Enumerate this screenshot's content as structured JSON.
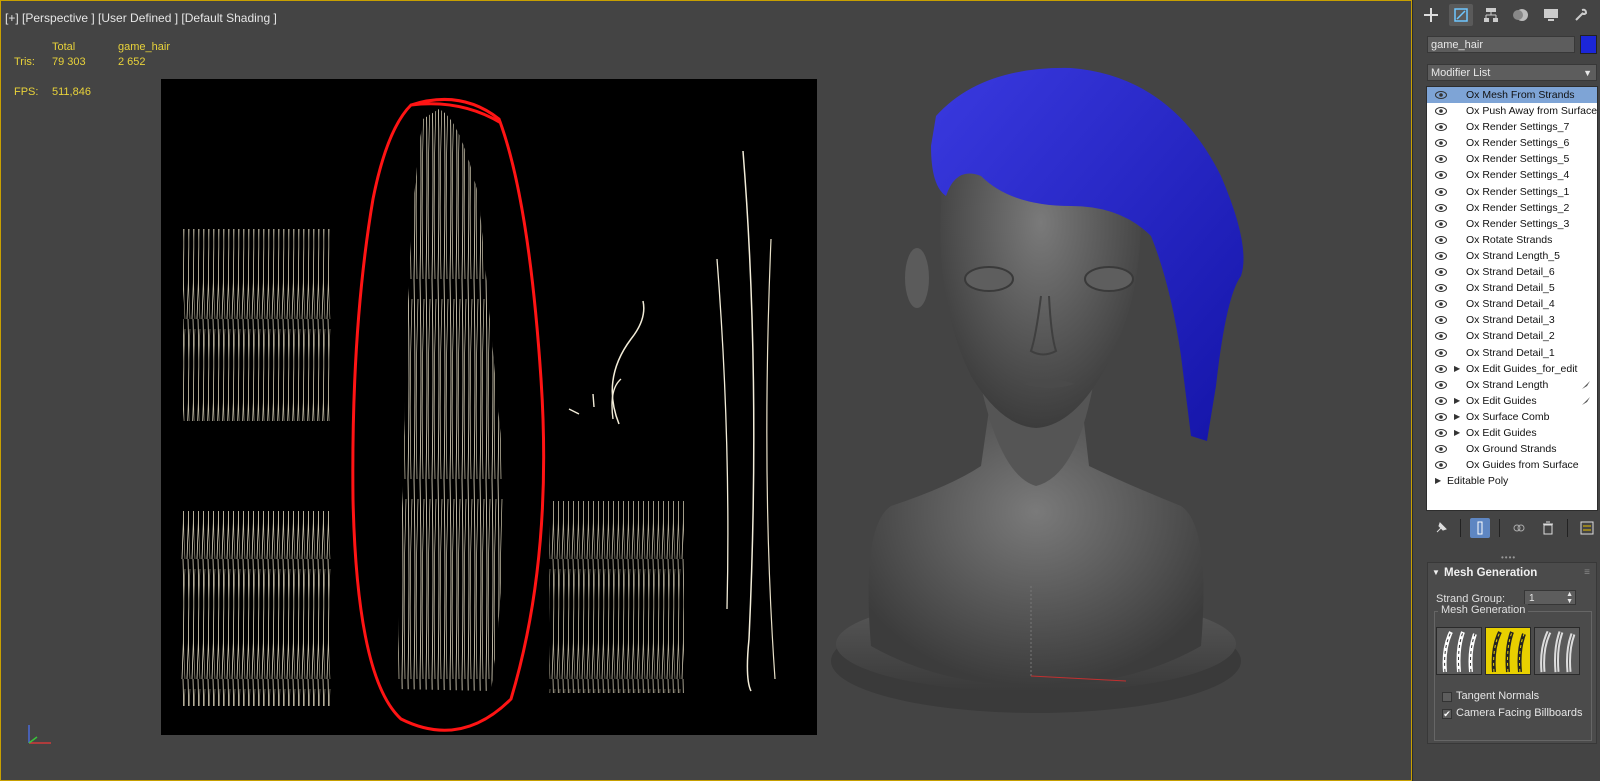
{
  "viewport": {
    "label": "[+] [Perspective ] [User Defined ] [Default Shading ]",
    "stats": {
      "total_header": "Total",
      "object_header": "game_hair",
      "tris_label": "Tris:",
      "tris_total": "79 303",
      "tris_object": "2 652",
      "fps_label": "FPS:",
      "fps_value": "511,846"
    }
  },
  "command_panel": {
    "tabs": [
      "create-icon",
      "modify-icon",
      "hierarchy-icon",
      "motion-icon",
      "display-icon",
      "utilities-icon"
    ],
    "object_name": "game_hair",
    "object_color": "#1b26d8",
    "modifier_list_label": "Modifier List",
    "modifier_stack": [
      {
        "label": "Ox Mesh From Strands",
        "selected": true
      },
      {
        "label": "Ox Push Away from Surface"
      },
      {
        "label": "Ox Render Settings_7"
      },
      {
        "label": "Ox Render Settings_6"
      },
      {
        "label": "Ox Render Settings_5"
      },
      {
        "label": "Ox Render Settings_4"
      },
      {
        "label": "Ox Render Settings_1"
      },
      {
        "label": "Ox Render Settings_2"
      },
      {
        "label": "Ox Render Settings_3"
      },
      {
        "label": "Ox Rotate Strands"
      },
      {
        "label": "Ox Strand Length_5"
      },
      {
        "label": "Ox Strand Detail_6"
      },
      {
        "label": "Ox Strand Detail_5"
      },
      {
        "label": "Ox Strand Detail_4"
      },
      {
        "label": "Ox Strand Detail_3"
      },
      {
        "label": "Ox Strand Detail_2"
      },
      {
        "label": "Ox Strand Detail_1"
      },
      {
        "label": "Ox Edit Guides_for_edit",
        "expandable": true
      },
      {
        "label": "Ox Strand Length",
        "pinned": true
      },
      {
        "label": "Ox Edit Guides",
        "expandable": true,
        "pinned": true
      },
      {
        "label": "Ox Surface Comb",
        "expandable": true
      },
      {
        "label": "Ox Edit Guides",
        "expandable": true
      },
      {
        "label": "Ox Ground Strands"
      },
      {
        "label": "Ox Guides from Surface"
      }
    ],
    "base_object": "Editable Poly",
    "rollout": {
      "title": "Mesh Generation",
      "strand_group_label": "Strand Group:",
      "strand_group_value": "1",
      "group_title": "Mesh Generation",
      "tangent_normals_label": "Tangent Normals",
      "tangent_normals_checked": false,
      "camera_facing_label": "Camera Facing Billboards",
      "camera_facing_checked": true
    }
  }
}
